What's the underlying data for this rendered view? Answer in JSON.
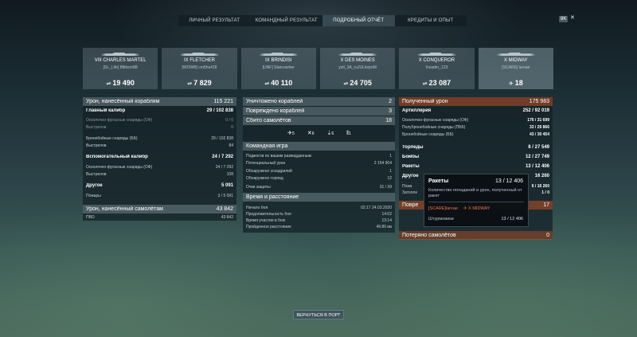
{
  "tabs": [
    {
      "label": "ЛИЧНЫЙ РЕЗУЛЬТАТ",
      "active": false
    },
    {
      "label": "КОМАНДНЫЙ РЕЗУЛЬТАТ",
      "active": false
    },
    {
      "label": "ПОДРОБНЫЙ ОТЧЁТ",
      "active": true
    },
    {
      "label": "КРЕДИТЫ И ОПЫТ",
      "active": false
    }
  ],
  "corner": {
    "badge": "8K",
    "close": "✕"
  },
  "ships": [
    {
      "name": "VIII CHARLES MARTEL",
      "player": "[SL_Life] 8fkbsrn88",
      "value": "19 490",
      "icon": "torpedo-icon"
    },
    {
      "name": "IX FLETCHER",
      "player": "[WOWB] cm5hs418",
      "value": "7 829",
      "icon": "torpedo-icon"
    },
    {
      "name": "IX BRINDISI",
      "player": "[UNF] Starcrasher",
      "value": "40 110",
      "icon": "torpedo-icon"
    },
    {
      "name": "X DES MOINES",
      "player": "ystl_3A_ruJULkepoM",
      "value": "24 705",
      "icon": "torpedo-icon"
    },
    {
      "name": "X CONQUEROR",
      "player": "Invader_123",
      "value": "23 087",
      "icon": "torpedo-icon"
    },
    {
      "name": "X MIDWAY",
      "player": "[SCARE] larvae",
      "value": "18",
      "icon": "plane-icon"
    }
  ],
  "left": {
    "dmg_ships": {
      "label": "Урон, нанесённый кораблям",
      "value": "115 221"
    },
    "main_battery": {
      "label": "Главный калибр",
      "value": "29 / 102 838"
    },
    "he_shells": {
      "label": "Осколочно-фугасные снаряды (ОФ)",
      "value": "0 / 0"
    },
    "shots1": {
      "label": "Выстрелов",
      "value": "0"
    },
    "ap_shells": {
      "label": "Бронебойные снаряды (ББ)",
      "value": "29 / 102 838"
    },
    "shots2": {
      "label": "Выстрелов",
      "value": "84"
    },
    "secondary": {
      "label": "Вспомогательный калибр",
      "value": "24 / 7 292"
    },
    "sec_he": {
      "label": "Осколочно-фугасные снаряды (ОФ)",
      "value": "24 / 7 292"
    },
    "shots3": {
      "label": "Выстрелов",
      "value": "108"
    },
    "other": {
      "label": "Другое",
      "value": "5 091"
    },
    "fires": {
      "label": "Пожары",
      "value": "3 / 5 091"
    },
    "dmg_planes": {
      "label": "Урон, нанесённый самолётам",
      "value": "43 842"
    },
    "aa": {
      "label": "ПВО",
      "value": "43 842"
    }
  },
  "middle": {
    "destroyed": {
      "label": "Уничтожено кораблей",
      "value": "2"
    },
    "damaged": {
      "label": "Повреждено кораблей",
      "value": "3"
    },
    "planes": {
      "label": "Сбито самолётов",
      "value": "18"
    },
    "plane_icons": [
      {
        "icon": "fighter-icon",
        "value": "5"
      },
      {
        "icon": "bomber-icon",
        "value": "6"
      },
      {
        "icon": "torpedo-bomber-icon",
        "value": "6"
      },
      {
        "icon": "rocket-plane-icon",
        "value": "1"
      }
    ],
    "team": {
      "label": "Командная игра"
    },
    "spotted_dmg": {
      "label": "Поджогов по вашим разведданным",
      "value": "1"
    },
    "potential": {
      "label": "Потенциальный урон",
      "value": "2 154 904"
    },
    "spotted_squads": {
      "label": "Обнаружено эскадрилий",
      "value": "1"
    },
    "spotted_torps": {
      "label": "Обнаружено торпед",
      "value": "12"
    },
    "defense": {
      "label": "Очки защиты",
      "value": "31 / 39"
    },
    "time": {
      "label": "Время и расстояние"
    },
    "start": {
      "label": "Начало боя",
      "value": "02:17  24.03.2020"
    },
    "duration": {
      "label": "Продолжительность боя",
      "value": "14:02"
    },
    "participation": {
      "label": "Время участия в бою",
      "value": "13:14"
    },
    "distance": {
      "label": "Пройденное расстояние",
      "value": "49.86 км"
    }
  },
  "right": {
    "received": {
      "label": "Полученный урон",
      "value": "175 983"
    },
    "artillery": {
      "label": "Артиллерия",
      "value": "252 / 92 019"
    },
    "r_he": {
      "label": "Осколочно-фугасные снаряды (ОФ)",
      "value": "176 / 31 699"
    },
    "r_sap": {
      "label": "Полубронебойные снаряды (ПББ)",
      "value": "33 / 29 866"
    },
    "r_ap": {
      "label": "Бронебойные снаряды (ББ)",
      "value": "43 / 30 454"
    },
    "torps": {
      "label": "Торпеды",
      "value": "8 / 27 549"
    },
    "bombs": {
      "label": "Бомбы",
      "value": "12 / 27 749"
    },
    "rockets": {
      "label": "Ракеты",
      "value": "13 / 12 406"
    },
    "other": {
      "label": "Другое",
      "value": "16 260"
    },
    "fires": {
      "label": "Пожа",
      "value": "6 / 16 260"
    },
    "flood": {
      "label": "Затопле",
      "value": "1 / 0"
    },
    "damaged_mod": {
      "label": "Повре",
      "value": "17"
    },
    "lost_planes": {
      "label": "Потеряно самолётов",
      "value": "0"
    }
  },
  "tooltip": {
    "title": "Ракеты",
    "value": "13 / 12 406",
    "desc": "Количество попаданий и урон, полученный от ракет",
    "player": "[SCARE]larvae",
    "ship": "X MIDWAY",
    "sub_label": "Штурмовики",
    "sub_value": "13 / 12 406"
  },
  "back_button": "ВЕРНУТЬСЯ В ПОРТ"
}
